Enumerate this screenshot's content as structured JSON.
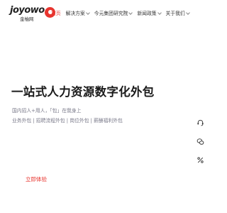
{
  "brand": {
    "logo_text": "joyowo",
    "logo_sub": "金柚网"
  },
  "nav": {
    "items": [
      {
        "label": "首页",
        "has_dropdown": false,
        "active": true
      },
      {
        "label": "解决方案",
        "has_dropdown": true,
        "active": false
      },
      {
        "label": "今元集团研究院",
        "has_dropdown": true,
        "active": false
      },
      {
        "label": "新闻政策",
        "has_dropdown": true,
        "active": false
      },
      {
        "label": "关于我们",
        "has_dropdown": true,
        "active": false
      }
    ]
  },
  "hero": {
    "title": "一站式人力资源数字化外包",
    "line1": "国内招人+用人，「包」在我身上",
    "line2": "业务外包 | 招聘流程外包 | 岗位外包 | 薪酬福利外包",
    "cta": "立即体验"
  },
  "float_bar": {
    "icons": [
      "headset-icon",
      "wechat-icon",
      "percent-icon"
    ]
  },
  "colors": {
    "accent": "#e8352f",
    "text": "#1a1a1a",
    "muted": "#7a7a8a"
  }
}
